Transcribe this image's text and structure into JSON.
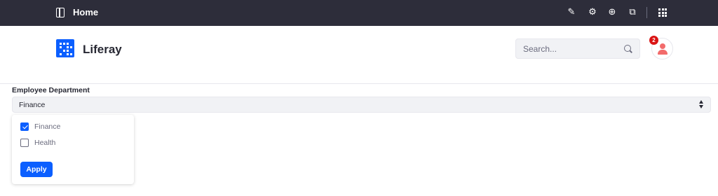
{
  "topbar": {
    "title": "Home",
    "icons": [
      "sidebar-toggle-icon",
      "pencil-icon",
      "gear-icon",
      "simulation-icon",
      "preview-icon",
      "apps-grid-icon"
    ]
  },
  "header": {
    "site_name": "Liferay",
    "search": {
      "placeholder": "Search..."
    },
    "notification_count": "2"
  },
  "filter": {
    "label": "Employee Department",
    "selected_value": "Finance",
    "options": [
      {
        "label": "Finance",
        "checked": true
      },
      {
        "label": "Health",
        "checked": false
      }
    ],
    "apply_label": "Apply"
  },
  "colors": {
    "topbar_bg": "#2d2d3a",
    "accent": "#0b5fff",
    "badge": "#da1414",
    "avatar": "#f26b6b"
  }
}
